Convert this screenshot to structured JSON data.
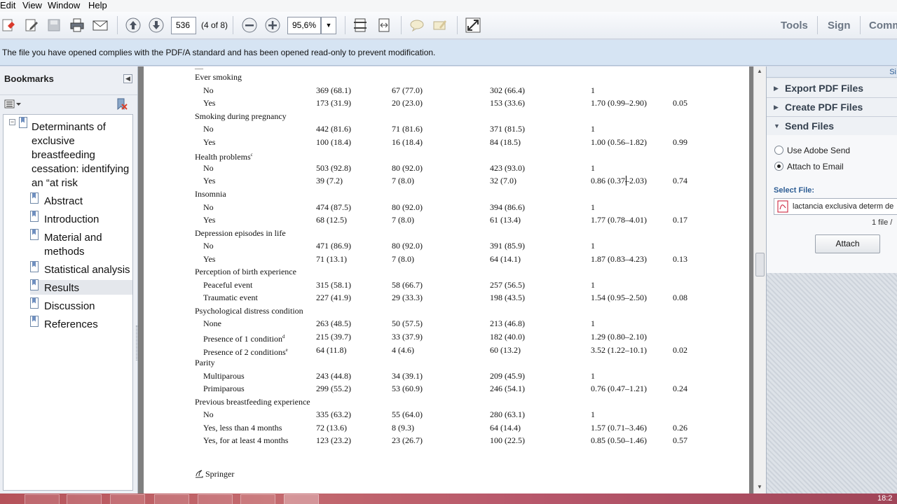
{
  "menu": [
    "Edit",
    "View",
    "Window",
    "Help"
  ],
  "toolbar": {
    "page_number": "536",
    "page_of": "(4 of 8)",
    "zoom": "95,6%",
    "tools": "Tools",
    "sign": "Sign",
    "comment": "Comm"
  },
  "infobar": {
    "message": "The file you have opened complies with the PDF/A standard and has been opened read-only to prevent modification."
  },
  "bookmarks": {
    "title": "Bookmarks",
    "root": [
      "Determinants of",
      "exclusive",
      "breastfeeding",
      "cessation: identifying",
      "an “at risk"
    ],
    "items": [
      {
        "label": "Abstract"
      },
      {
        "label": "Introduction"
      },
      {
        "label": "Material and"
      },
      {
        "label": "methods"
      },
      {
        "label": "Statistical analysis"
      },
      {
        "label": "Results"
      },
      {
        "label": "Discussion"
      },
      {
        "label": "References"
      }
    ]
  },
  "table": {
    "top_fragment": [
      "__",
      "",
      "",
      "",
      "",
      ""
    ],
    "rows": [
      {
        "label": "Ever smoking",
        "indent": false,
        "c1": "",
        "c2": "",
        "c3": "",
        "c4": "",
        "c5": ""
      },
      {
        "label": "No",
        "indent": true,
        "c1": "369 (68.1)",
        "c2": "67 (77.0)",
        "c3": "302 (66.4)",
        "c4": "1",
        "c5": ""
      },
      {
        "label": "Yes",
        "indent": true,
        "c1": "173 (31.9)",
        "c2": "20 (23.0)",
        "c3": "153 (33.6)",
        "c4": "1.70 (0.99–2.90)",
        "c5": "0.05"
      },
      {
        "label": "Smoking during pregnancy",
        "indent": false,
        "c1": "",
        "c2": "",
        "c3": "",
        "c4": "",
        "c5": ""
      },
      {
        "label": "No",
        "indent": true,
        "c1": "442 (81.6)",
        "c2": "71 (81.6)",
        "c3": "371 (81.5)",
        "c4": "1",
        "c5": ""
      },
      {
        "label": "Yes",
        "indent": true,
        "c1": "100 (18.4)",
        "c2": "16 (18.4)",
        "c3": "84 (18.5)",
        "c4": "1.00 (0.56–1.82)",
        "c5": "0.99"
      },
      {
        "label": "Health problems",
        "sup": "c",
        "indent": false,
        "c1": "",
        "c2": "",
        "c3": "",
        "c4": "",
        "c5": ""
      },
      {
        "label": "No",
        "indent": true,
        "c1": "503 (92.8)",
        "c2": "80 (92.0)",
        "c3": "423 (93.0)",
        "c4": "1",
        "c5": ""
      },
      {
        "label": "Yes",
        "indent": true,
        "c1": "39 (7.2)",
        "c2": "7 (8.0)",
        "c3": "32 (7.0)",
        "c4": "0.86 (0.37–2.03)",
        "c5": "0.74"
      },
      {
        "label": "Insomnia",
        "indent": false,
        "c1": "",
        "c2": "",
        "c3": "",
        "c4": "",
        "c5": ""
      },
      {
        "label": "No",
        "indent": true,
        "c1": "474 (87.5)",
        "c2": "80 (92.0)",
        "c3": "394 (86.6)",
        "c4": "1",
        "c5": ""
      },
      {
        "label": "Yes",
        "indent": true,
        "c1": "68 (12.5)",
        "c2": "7 (8.0)",
        "c3": "61 (13.4)",
        "c4": "1.77 (0.78–4.01)",
        "c5": "0.17"
      },
      {
        "label": "Depression episodes in life",
        "indent": false,
        "c1": "",
        "c2": "",
        "c3": "",
        "c4": "",
        "c5": ""
      },
      {
        "label": "No",
        "indent": true,
        "c1": "471 (86.9)",
        "c2": "80 (92.0)",
        "c3": "391 (85.9)",
        "c4": "1",
        "c5": ""
      },
      {
        "label": "Yes",
        "indent": true,
        "c1": "71 (13.1)",
        "c2": "7 (8.0)",
        "c3": "64 (14.1)",
        "c4": "1.87 (0.83–4.23)",
        "c5": "0.13"
      },
      {
        "label": "Perception of birth experience",
        "indent": false,
        "c1": "",
        "c2": "",
        "c3": "",
        "c4": "",
        "c5": ""
      },
      {
        "label": "Peaceful event",
        "indent": true,
        "c1": "315 (58.1)",
        "c2": "58 (66.7)",
        "c3": "257 (56.5)",
        "c4": "1",
        "c5": ""
      },
      {
        "label": "Traumatic event",
        "indent": true,
        "c1": "227 (41.9)",
        "c2": "29 (33.3)",
        "c3": "198 (43.5)",
        "c4": "1.54 (0.95–2.50)",
        "c5": "0.08"
      },
      {
        "label": "Psychological distress condition",
        "indent": false,
        "c1": "",
        "c2": "",
        "c3": "",
        "c4": "",
        "c5": ""
      },
      {
        "label": "None",
        "indent": true,
        "c1": "263 (48.5)",
        "c2": "50 (57.5)",
        "c3": "213 (46.8)",
        "c4": "1",
        "c5": ""
      },
      {
        "label": "Presence of 1 condition",
        "sup": "d",
        "indent": true,
        "c1": "215 (39.7)",
        "c2": "33 (37.9)",
        "c3": "182 (40.0)",
        "c4": "1.29 (0.80–2.10)",
        "c5": ""
      },
      {
        "label": "Presence of 2 conditions",
        "sup": "e",
        "indent": true,
        "c1": "64 (11.8)",
        "c2": "4 (4.6)",
        "c3": "60 (13.2)",
        "c4": "3.52 (1.22–10.1)",
        "c5": "0.02"
      },
      {
        "label": "Parity",
        "indent": false,
        "c1": "",
        "c2": "",
        "c3": "",
        "c4": "",
        "c5": ""
      },
      {
        "label": "Multiparous",
        "indent": true,
        "c1": "243 (44.8)",
        "c2": "34 (39.1)",
        "c3": "209 (45.9)",
        "c4": "1",
        "c5": ""
      },
      {
        "label": "Primiparous",
        "indent": true,
        "c1": "299 (55.2)",
        "c2": "53 (60.9)",
        "c3": "246 (54.1)",
        "c4": "0.76 (0.47–1.21)",
        "c5": "0.24"
      },
      {
        "label": "Previous breastfeeding experience",
        "indent": false,
        "c1": "",
        "c2": "",
        "c3": "",
        "c4": "",
        "c5": ""
      },
      {
        "label": "No",
        "indent": true,
        "c1": "335 (63.2)",
        "c2": "55 (64.0)",
        "c3": "280 (63.1)",
        "c4": "1",
        "c5": ""
      },
      {
        "label": "Yes, less than 4 months",
        "indent": true,
        "c1": "72 (13.6)",
        "c2": "8 (9.3)",
        "c3": "64 (14.4)",
        "c4": "1.57 (0.71–3.46)",
        "c5": "0.26"
      },
      {
        "label": "Yes, for at least 4 months",
        "indent": true,
        "c1": "123 (23.2)",
        "c2": "23 (26.7)",
        "c3": "100 (22.5)",
        "c4": "0.85 (0.50–1.46)",
        "c5": "0.57"
      }
    ],
    "publisher": "Springer"
  },
  "rightpane": {
    "top_label": "Si",
    "sections": [
      "Export PDF Files",
      "Create PDF Files",
      "Send Files"
    ],
    "radio_adobe": "Use Adobe Send",
    "radio_email": "Attach to Email",
    "select_file_label": "Select File:",
    "file_name": "lactancia exclusiva determ de",
    "file_count": "1 file /",
    "attach_button": "Attach"
  },
  "taskbar": {
    "clock": "18:2"
  },
  "colors": {
    "pdf_red": "#c8102e",
    "link_blue": "#2d5d94"
  }
}
